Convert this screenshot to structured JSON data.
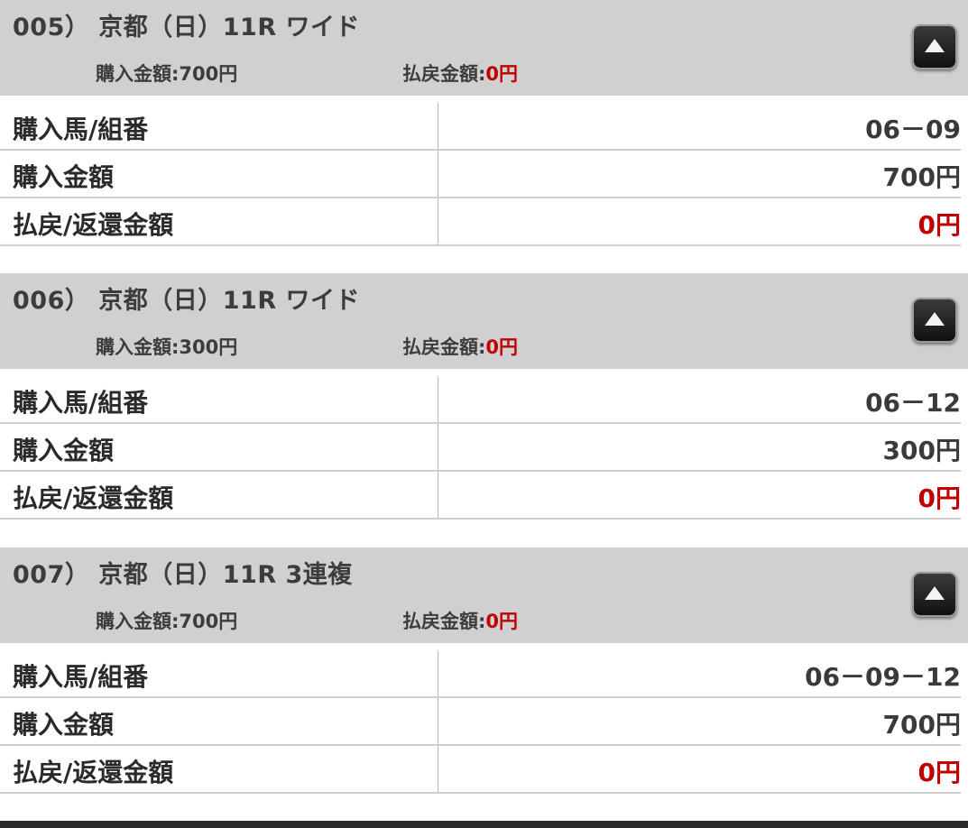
{
  "bets": [
    {
      "title": "005） 京都（日）11R ワイド",
      "purchase_label": "購入金額:",
      "purchase_value": "700円",
      "refund_label": "払戻金額:",
      "refund_value": "0円",
      "rows": [
        {
          "label": "購入馬/組番",
          "value": "06－09"
        },
        {
          "label": "購入金額",
          "value": "700円"
        },
        {
          "label": "払戻/返還金額",
          "value": "0円"
        }
      ]
    },
    {
      "title": "006） 京都（日）11R ワイド",
      "purchase_label": "購入金額:",
      "purchase_value": "300円",
      "refund_label": "払戻金額:",
      "refund_value": "0円",
      "rows": [
        {
          "label": "購入馬/組番",
          "value": "06－12"
        },
        {
          "label": "購入金額",
          "value": "300円"
        },
        {
          "label": "払戻/返還金額",
          "value": "0円"
        }
      ]
    },
    {
      "title": "007） 京都（日）11R 3連複",
      "purchase_label": "購入金額:",
      "purchase_value": "700円",
      "refund_label": "払戻金額:",
      "refund_value": "0円",
      "rows": [
        {
          "label": "購入馬/組番",
          "value": "06－09－12"
        },
        {
          "label": "購入金額",
          "value": "700円"
        },
        {
          "label": "払戻/返還金額",
          "value": "0円"
        }
      ]
    }
  ],
  "collapse_icon": "triangle-up-icon",
  "colors": {
    "header_bg": "#d0d0d0",
    "refund_red": "#c00000"
  }
}
